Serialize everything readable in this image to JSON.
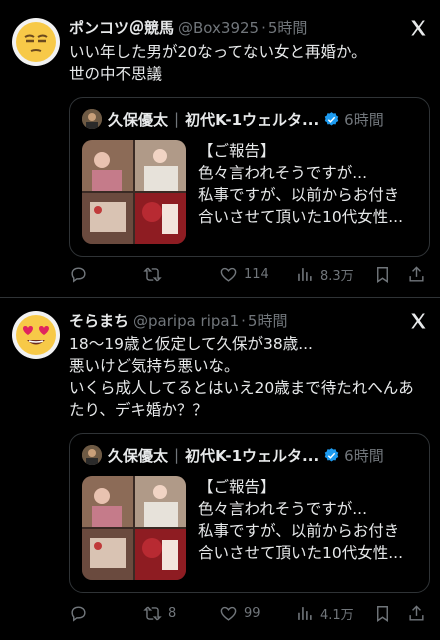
{
  "posts": [
    {
      "display_name": "ポンコツ＠競馬",
      "handle": "@Box3925",
      "time": "5時間",
      "text_lines": [
        "いい年した男が20なってない女と再婚か。",
        "世の中不思議"
      ],
      "quote": {
        "name": "久保優太",
        "title": "初代K-1ウェルタ...",
        "time": "6時間",
        "text_lines": [
          "【ご報告】",
          "色々言われそうですが...",
          "私事ですが、以前からお付き",
          "合いさせて頂いた10代女性..."
        ]
      },
      "actions": {
        "reply": "",
        "repost": "",
        "like": "114",
        "views": "8.3万"
      }
    },
    {
      "display_name": "そらまち",
      "handle": "@paripa ripa1",
      "time": "5時間",
      "text_lines": [
        "18〜19歳と仮定して久保が38歳...",
        "悪いけど気持ち悪いな。",
        "いくら成人してるとはいえ20歳まで待たれへんあ",
        "たり、デキ婚か？？"
      ],
      "quote": {
        "name": "久保優太",
        "title": "初代K-1ウェルタ...",
        "time": "6時間",
        "text_lines": [
          "【ご報告】",
          "色々言われそうですが...",
          "私事ですが、以前からお付き",
          "合いさせて頂いた10代女性..."
        ]
      },
      "actions": {
        "reply": "",
        "repost": "8",
        "like": "99",
        "views": "4.1万"
      }
    }
  ],
  "colors": {
    "background": "#000000",
    "text": "#e7e9ea",
    "muted": "#71767b",
    "verified": "#1d9bf0",
    "border": "#2f3336"
  },
  "icons": [
    "reply-icon",
    "repost-icon",
    "like-icon",
    "views-icon",
    "bookmark-icon",
    "share-icon",
    "x-logo-icon",
    "verified-badge-icon"
  ]
}
